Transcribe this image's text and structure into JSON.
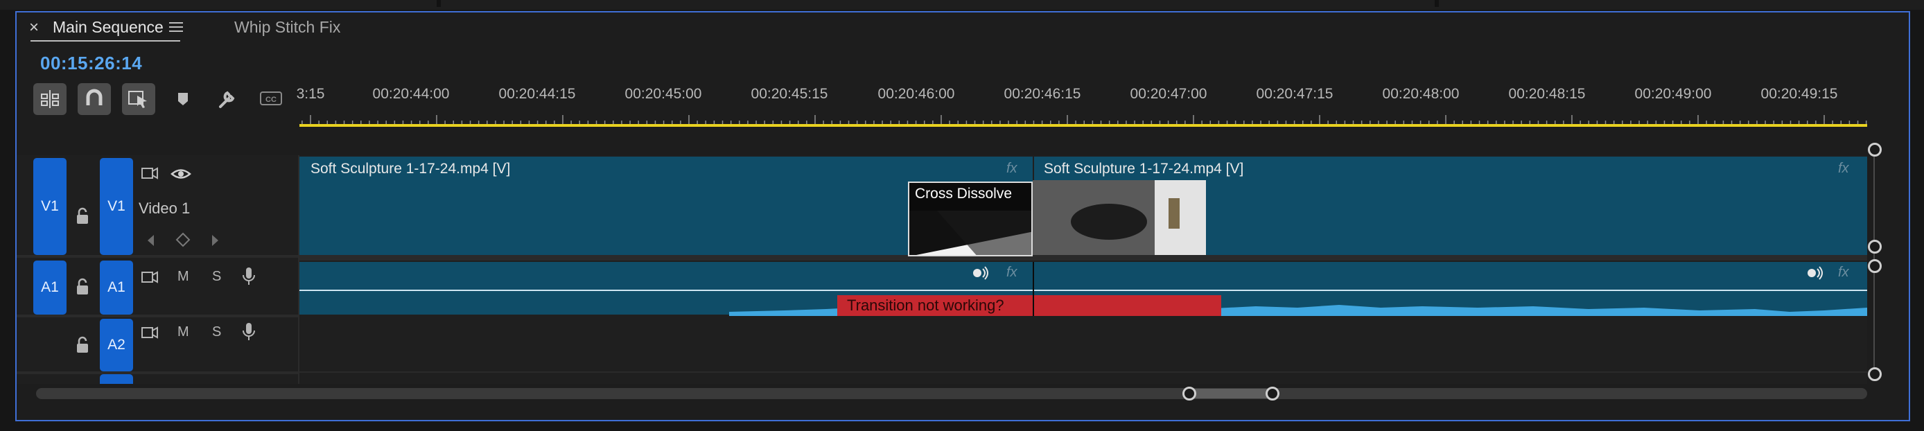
{
  "tabs": {
    "close_symbol": "×",
    "active": "Main Sequence",
    "other": "Whip Stitch Fix"
  },
  "timecode": "00:15:26:14",
  "toolbar": [
    {
      "name": "insert-sequence-nested-icon",
      "glyph": "⊞",
      "active": true
    },
    {
      "name": "snap-magnet-icon",
      "glyph": "∩",
      "active": true
    },
    {
      "name": "linked-selection-icon",
      "glyph": "⇱",
      "active": true
    },
    {
      "name": "add-marker-icon",
      "glyph": "▼",
      "active": false
    },
    {
      "name": "wrench-settings-icon",
      "glyph": "🔧",
      "active": false
    },
    {
      "name": "captions-icon",
      "glyph": "CC",
      "active": false
    }
  ],
  "ruler": [
    "3:15",
    "00:20:44:00",
    "00:20:44:15",
    "00:20:45:00",
    "00:20:45:15",
    "00:20:46:00",
    "00:20:46:15",
    "00:20:47:00",
    "00:20:47:15",
    "00:20:48:00",
    "00:20:48:15",
    "00:20:49:00",
    "00:20:49:15"
  ],
  "tracks": {
    "v1": {
      "source": "V1",
      "target": "V1",
      "name": "Video 1"
    },
    "a1": {
      "source": "A1",
      "target": "A1",
      "mute": "M",
      "solo": "S"
    },
    "a2": {
      "target": "A2",
      "mute": "M",
      "solo": "S"
    }
  },
  "clips": {
    "video_left": "Soft Sculpture 1-17-24.mp4 [V]",
    "video_right": "Soft Sculpture 1-17-24.mp4 [V]",
    "fx": "fx",
    "transition": "Cross Dissolve"
  },
  "annotation": "Transition not working?",
  "colors": {
    "accent": "#3f6fd6",
    "timecode": "#5aa7f0",
    "track_button": "#1463cf",
    "clip": "#0f4d68",
    "playhead_bar": "#e8d120",
    "note": "#c5282f"
  }
}
